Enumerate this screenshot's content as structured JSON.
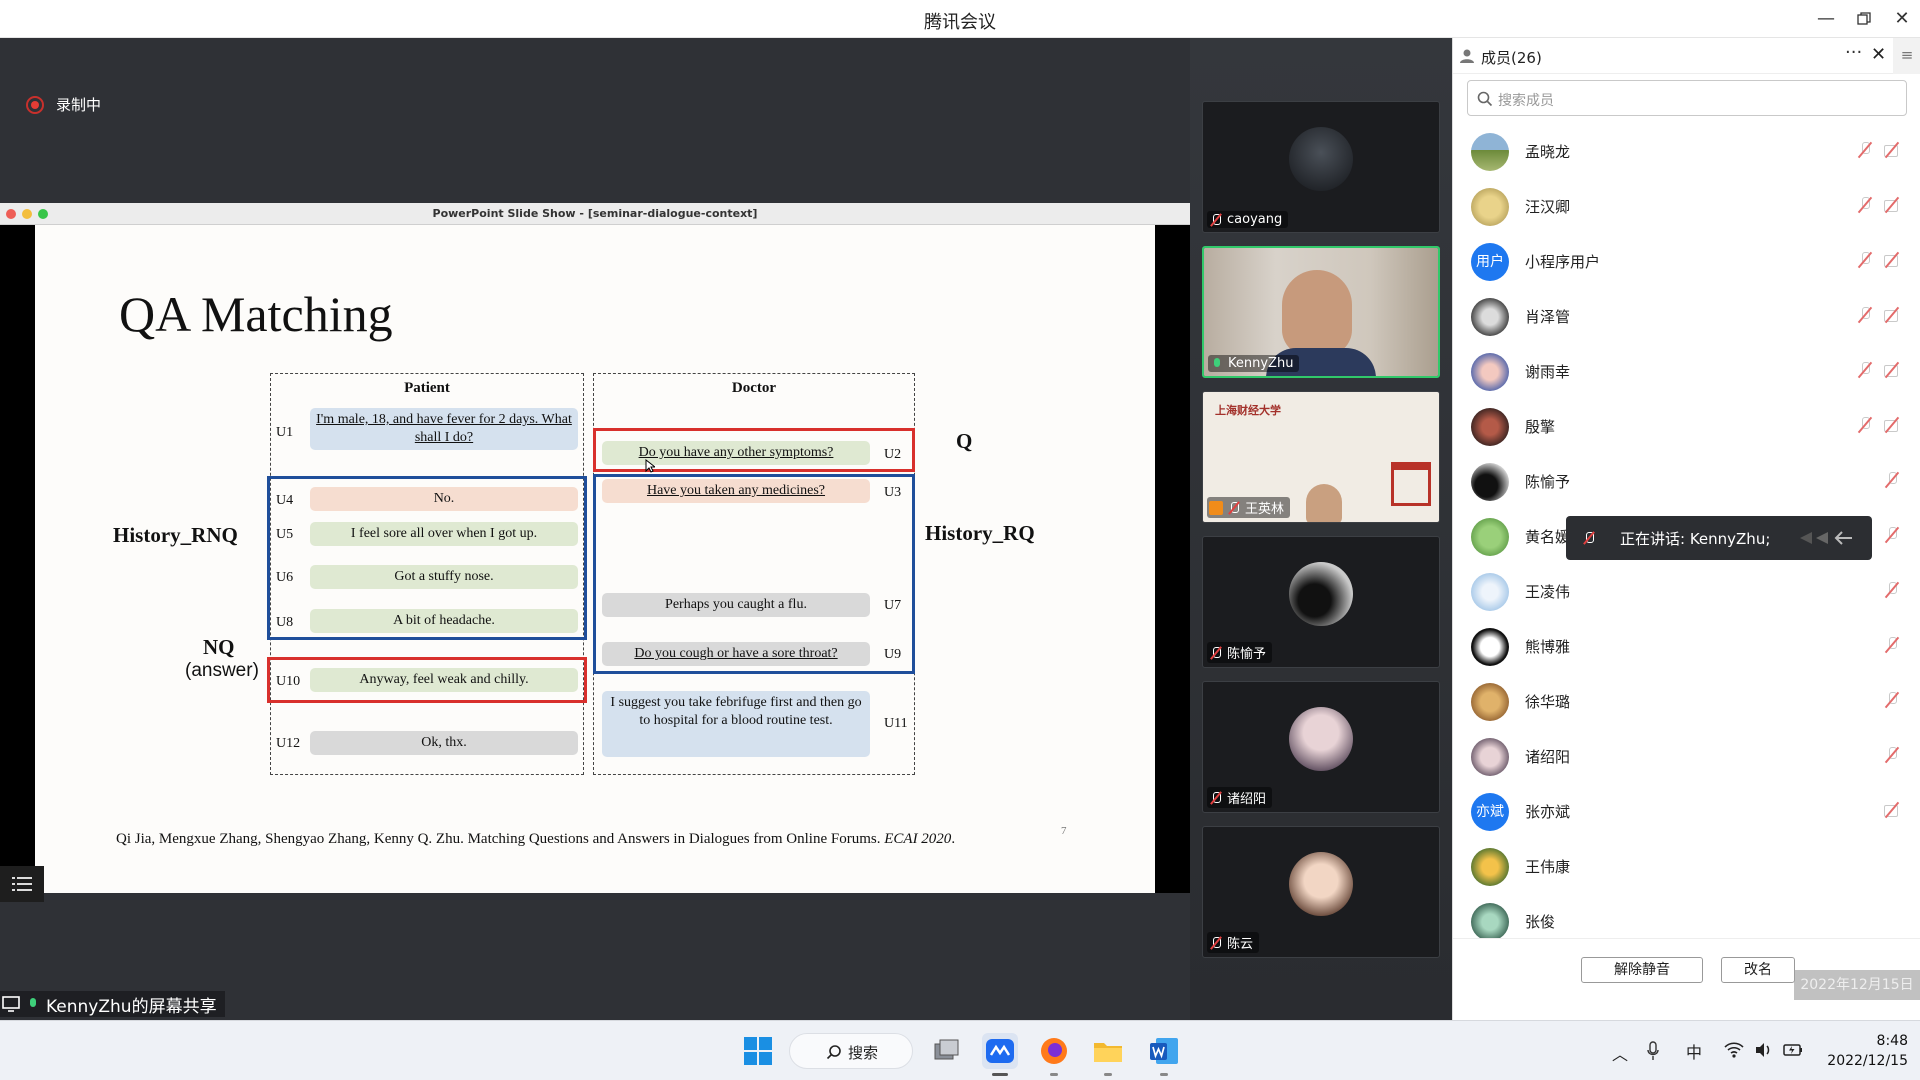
{
  "window": {
    "title": "腾讯会议"
  },
  "stage": {
    "recording_label": "录制中",
    "share_label": "KennyZhu的屏幕共享"
  },
  "ppt": {
    "window_title": "PowerPoint Slide Show - [seminar-dialogue-context]",
    "slide": {
      "title": "QA Matching",
      "patient_header": "Patient",
      "doctor_header": "Doctor",
      "patient_utterances": [
        {
          "id": "U1",
          "text": "I'm male, 18, and have fever for 2 days. What shall I do?"
        },
        {
          "id": "U4",
          "text": "No."
        },
        {
          "id": "U5",
          "text": "I feel sore all over when I got up."
        },
        {
          "id": "U6",
          "text": "Got a stuffy nose."
        },
        {
          "id": "U8",
          "text": "A bit of headache."
        },
        {
          "id": "U10",
          "text": "Anyway, feel weak and chilly."
        },
        {
          "id": "U12",
          "text": "Ok, thx."
        }
      ],
      "doctor_utterances": [
        {
          "id": "U2",
          "text": "Do you have any other symptoms?"
        },
        {
          "id": "U3",
          "text": "Have you taken any medicines?"
        },
        {
          "id": "U7",
          "text": "Perhaps you caught a flu."
        },
        {
          "id": "U9",
          "text": "Do you cough or have a sore throat?"
        },
        {
          "id": "U11",
          "text": "I suggest you take febrifuge first and then go to hospital for a blood routine test."
        }
      ],
      "labels": {
        "q": "Q",
        "history_rnq": "History_RNQ",
        "history_rq": "History_RQ",
        "nq": "NQ",
        "nq_sub": "(answer)"
      },
      "citation": "Qi Jia, Mengxue Zhang, Shengyao Zhang, Kenny Q. Zhu. Matching Questions and Answers in Dialogues from Online Forums.",
      "citation_venue": "ECAI 2020",
      "citation_end": ".",
      "page_number": "7"
    }
  },
  "videos": [
    {
      "name": "caoyang",
      "muted": true
    },
    {
      "name": "KennyZhu",
      "muted": false,
      "active": true
    },
    {
      "name": "王英林",
      "muted": true,
      "logo_text": "上海财经大学"
    },
    {
      "name": "陈愉予",
      "muted": true
    },
    {
      "name": "诸绍阳",
      "muted": true
    },
    {
      "name": "陈云",
      "muted": true
    }
  ],
  "members_panel": {
    "title": "成员(26)",
    "search_placeholder": "搜索成员",
    "members": [
      {
        "name": "孟晓龙",
        "cam": true
      },
      {
        "name": "汪汉卿",
        "cam": true
      },
      {
        "name": "小程序用户",
        "avatar_text": "用户",
        "cam": true
      },
      {
        "name": "肖泽管",
        "cam": true
      },
      {
        "name": "谢雨幸",
        "cam": true
      },
      {
        "name": "殷擎",
        "cam": true
      },
      {
        "name": "陈愉予",
        "cam": false
      },
      {
        "name": "黄名媛",
        "cam": false
      },
      {
        "name": "王凌伟",
        "cam": false
      },
      {
        "name": "熊博雅",
        "cam": false
      },
      {
        "name": "徐华璐",
        "cam": false
      },
      {
        "name": "诸绍阳",
        "cam": false
      },
      {
        "name": "张亦斌",
        "avatar_text": "亦斌",
        "cam": true,
        "mic_hidden": true
      },
      {
        "name": "王伟康",
        "cam": false,
        "mic_hidden": true
      },
      {
        "name": "张俊",
        "cam": false,
        "mic_hidden": true
      }
    ],
    "unmute_all_label": "解除静音",
    "rename_label": "改名",
    "date_overlay": "2022年12月15日",
    "speaking_label": "正在讲话: KennyZhu;"
  },
  "taskbar": {
    "search_label": "搜索",
    "ime_label": "中",
    "time": "8:48",
    "date": "2022/12/15"
  }
}
